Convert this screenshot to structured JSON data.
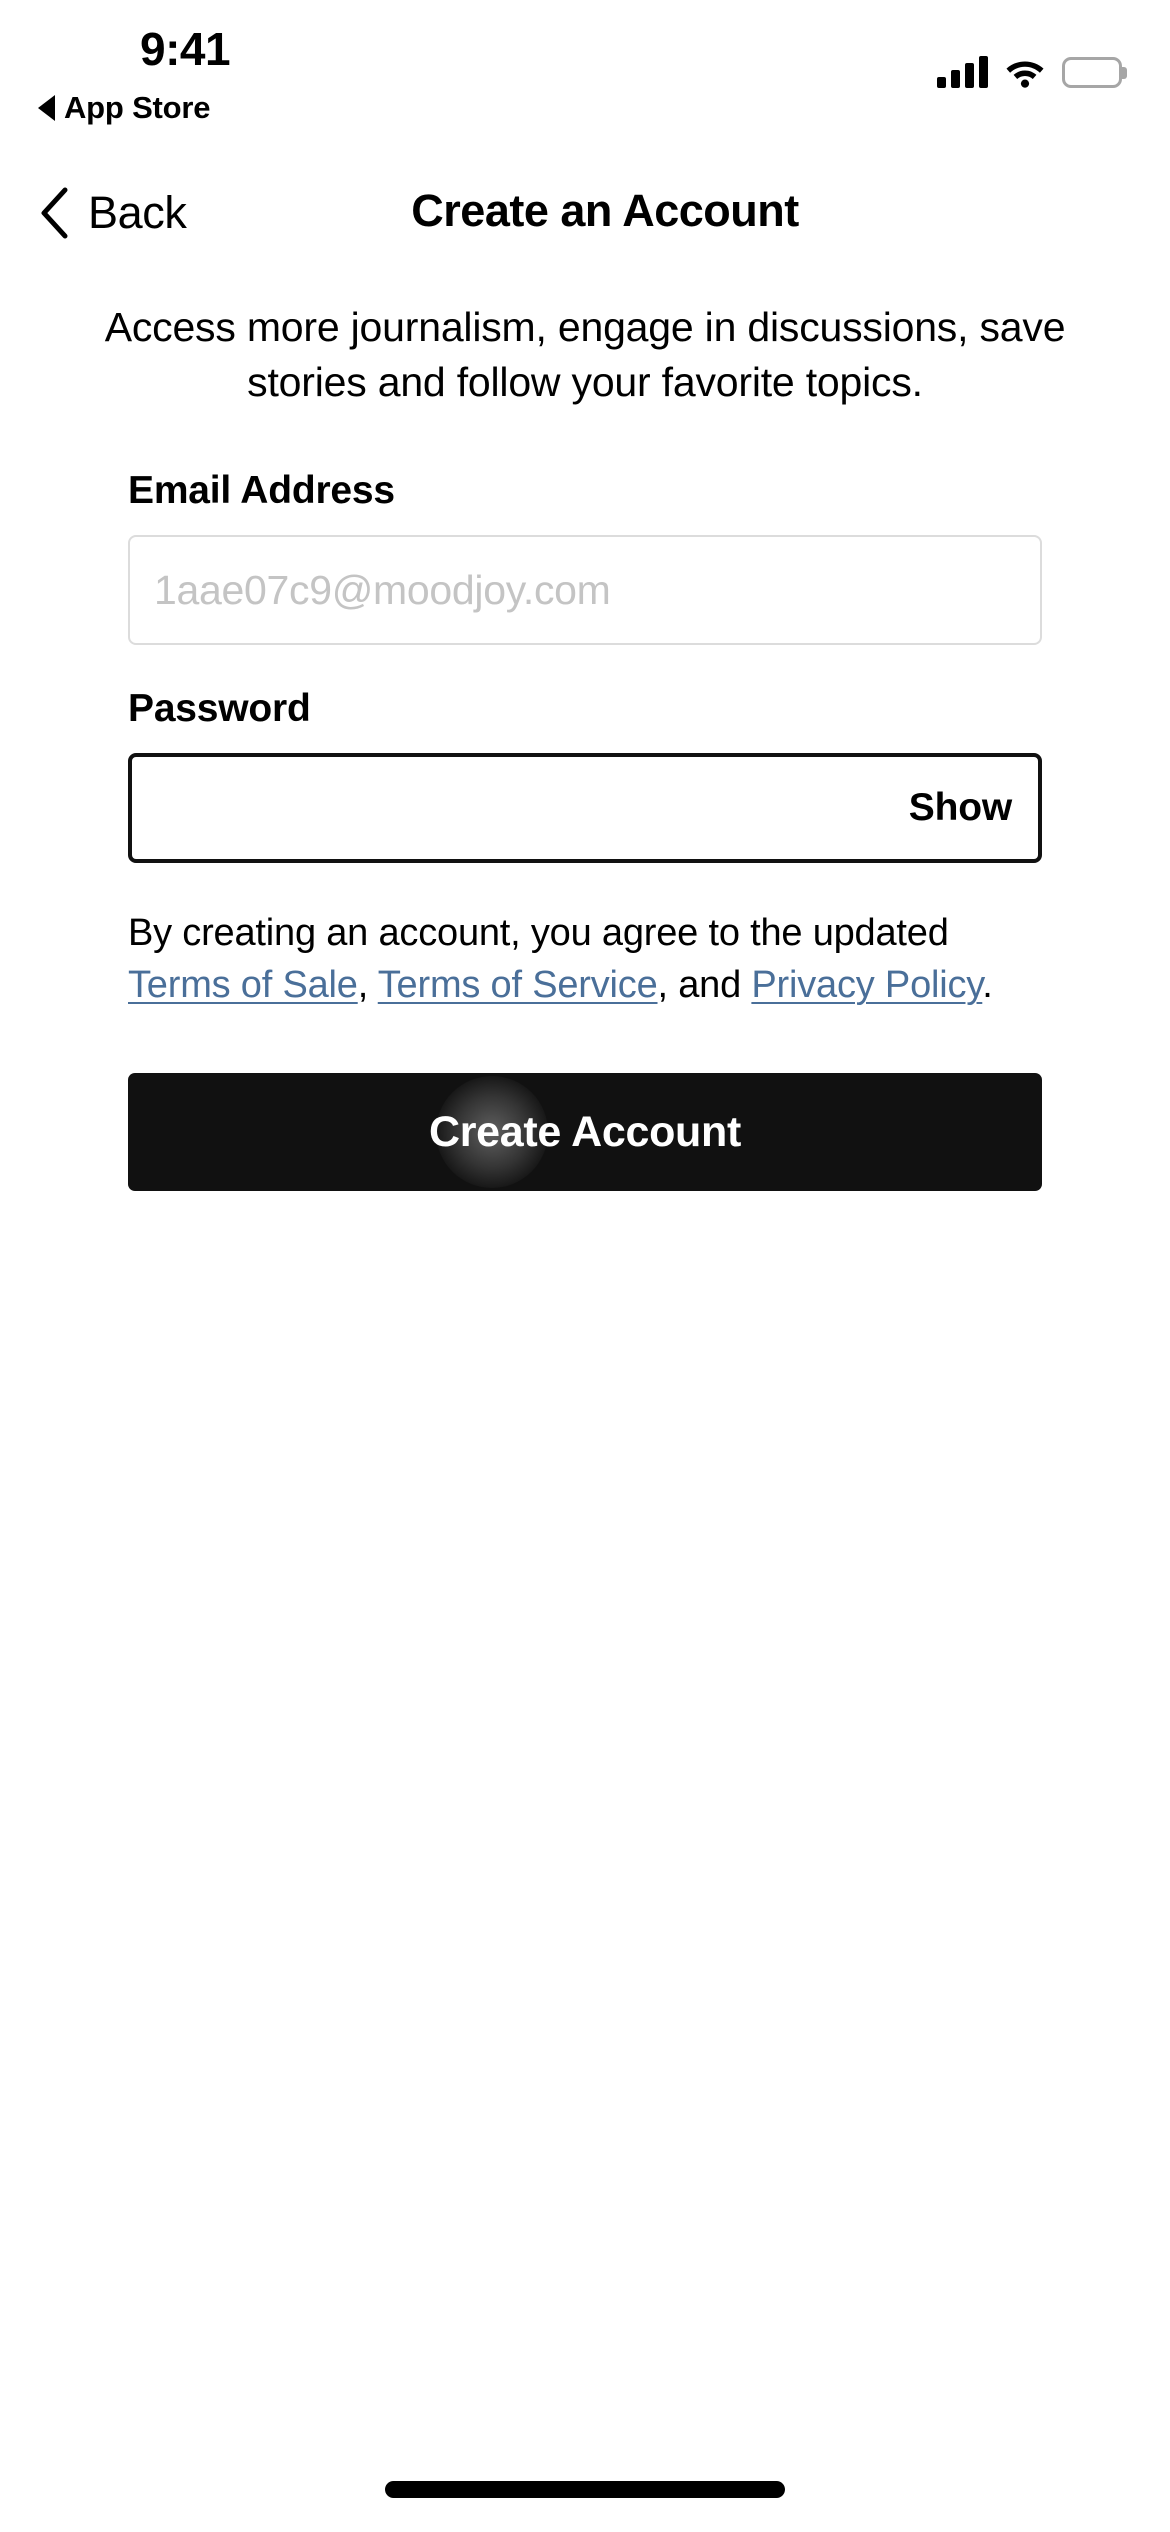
{
  "status_bar": {
    "time": "9:41",
    "return_to_app": "App Store",
    "return_arrow_icon": "triangle-left-icon",
    "cellular_icon": "cellular-bars-icon",
    "wifi_icon": "wifi-icon",
    "battery_icon": "battery-full-icon"
  },
  "navbar": {
    "back_icon": "chevron-left-icon",
    "back_label": "Back",
    "title": "Create an Account"
  },
  "main": {
    "intro": "Access more journalism, engage in discussions, save stories and follow your favorite topics.",
    "email": {
      "label": "Email Address",
      "placeholder": "1aae07c9@moodjoy.com",
      "value": ""
    },
    "password": {
      "label": "Password",
      "placeholder": "",
      "value": "",
      "toggle_label": "Show"
    },
    "legal": {
      "text_before": "By creating an account, you agree to the updated ",
      "link_terms_of_sale": "Terms of Sale",
      "separator_1": ", ",
      "link_terms_of_service": "Terms of Service",
      "separator_2": ", and ",
      "link_privacy_policy": "Privacy Policy",
      "text_after": "."
    },
    "submit_label": "Create Account"
  },
  "colors": {
    "link": "#4a6f99",
    "button_background": "#111111",
    "button_text": "#ffffff",
    "placeholder": "#c4c4c4",
    "input_border_idle": "#dcdcdc",
    "input_border_focused": "#111111",
    "page_background": "#ffffff"
  },
  "home_indicator": "home-indicator"
}
